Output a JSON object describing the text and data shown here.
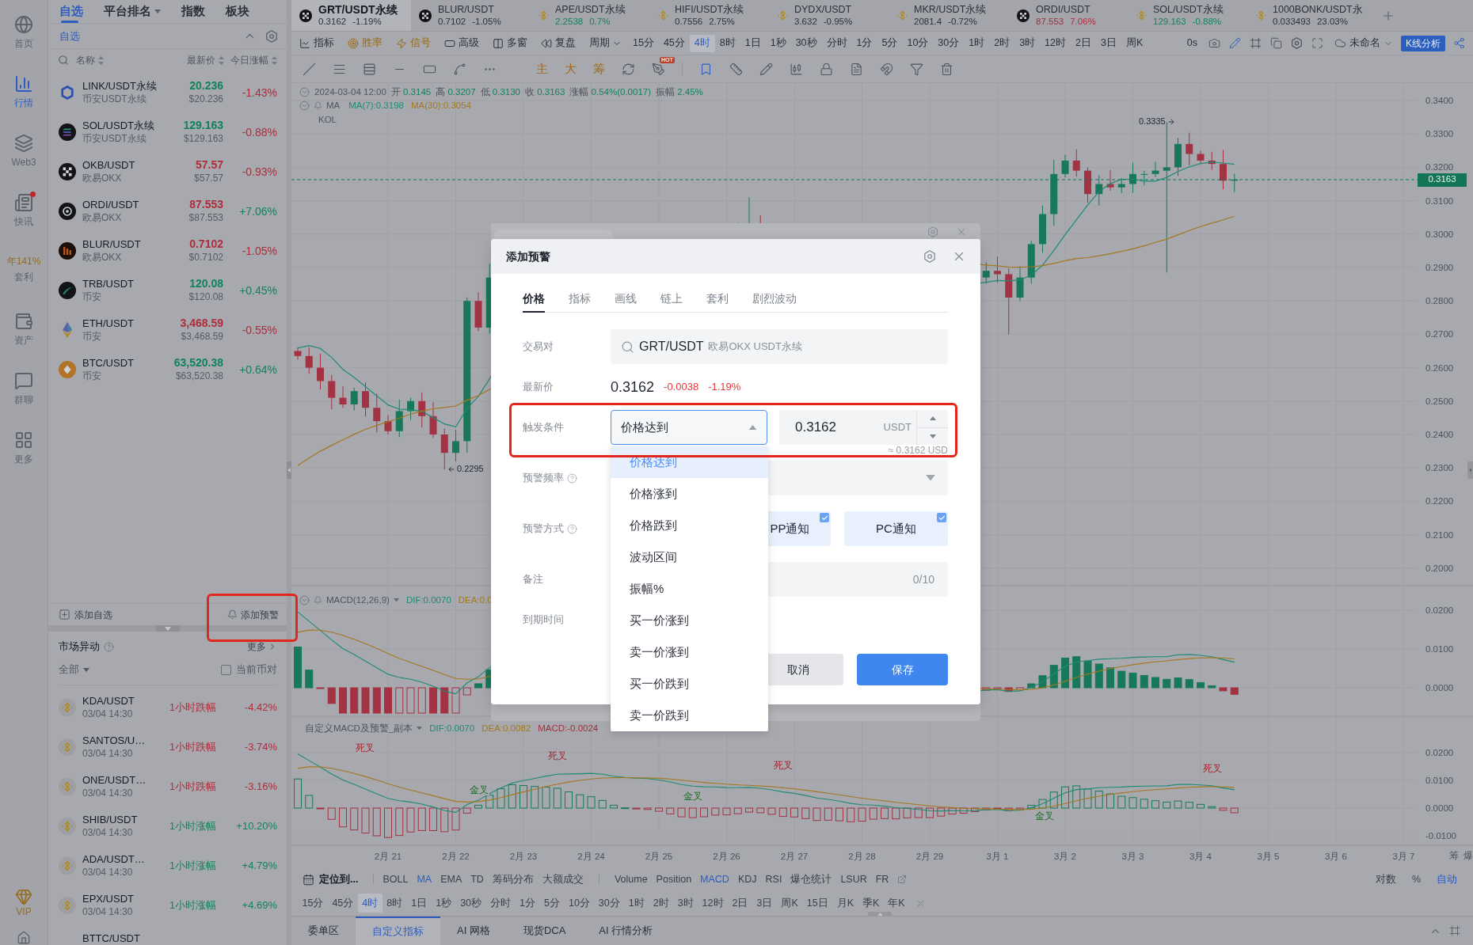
{
  "nav_rail": {
    "items": [
      {
        "kind": "nav",
        "label": "首页",
        "selected": false,
        "unread": false
      },
      {
        "kind": "nav",
        "label": "行情",
        "selected": true,
        "unread": false
      },
      {
        "kind": "nav",
        "label": "Web3",
        "selected": false,
        "unread": false
      },
      {
        "kind": "nav",
        "label": "快讯",
        "selected": false,
        "unread": true
      },
      {
        "kind": "promo",
        "highlight": "年141%",
        "label": "套利",
        "selected": false,
        "unread": false
      },
      {
        "kind": "nav",
        "label": "资产",
        "selected": false,
        "unread": false
      },
      {
        "kind": "nav",
        "label": "群聊",
        "selected": false,
        "unread": false
      },
      {
        "kind": "nav",
        "label": "更多",
        "selected": false,
        "unread": false
      }
    ],
    "vip": {
      "label": "VIP"
    }
  },
  "watchlist": {
    "tabs": [
      {
        "label": "自选",
        "selected": true,
        "dropdown": false
      },
      {
        "label": "平台排名",
        "selected": false,
        "dropdown": true
      },
      {
        "label": "指数",
        "selected": false,
        "dropdown": false
      },
      {
        "label": "板块",
        "selected": false,
        "dropdown": false
      }
    ],
    "group": {
      "title": "自选",
      "expanded": true
    },
    "columns": [
      {
        "label": "名称"
      },
      {
        "label": "最新价"
      },
      {
        "label": "今日涨幅"
      }
    ],
    "rows": [
      {
        "symbol": "LINK/USDT永续",
        "exchange": "币安USDT永续",
        "price": "20.236",
        "price_usd": "$20.236",
        "change": "-1.43%",
        "price_up": true,
        "change_up": false
      },
      {
        "symbol": "SOL/USDT永续",
        "exchange": "币安USDT永续",
        "price": "129.163",
        "price_usd": "$129.163",
        "change": "-0.88%",
        "price_up": true,
        "change_up": false
      },
      {
        "symbol": "OKB/USDT",
        "exchange": "欧易OKX",
        "price": "57.57",
        "price_usd": "$57.57",
        "change": "-0.93%",
        "price_up": false,
        "change_up": false
      },
      {
        "symbol": "ORDI/USDT",
        "exchange": "欧易OKX",
        "price": "87.553",
        "price_usd": "$87.553",
        "change": "+7.06%",
        "price_up": false,
        "change_up": true
      },
      {
        "symbol": "BLUR/USDT",
        "exchange": "欧易OKX",
        "price": "0.7102",
        "price_usd": "$0.7102",
        "change": "-1.05%",
        "price_up": false,
        "change_up": false
      },
      {
        "symbol": "TRB/USDT",
        "exchange": "币安",
        "price": "120.08",
        "price_usd": "$120.08",
        "change": "+0.45%",
        "price_up": true,
        "change_up": true
      },
      {
        "symbol": "ETH/USDT",
        "exchange": "币安",
        "price": "3,468.59",
        "price_usd": "$3,468.59",
        "change": "-0.55%",
        "price_up": false,
        "change_up": false
      },
      {
        "symbol": "BTC/USDT",
        "exchange": "币安",
        "price": "63,520.38",
        "price_usd": "$63,520.38",
        "change": "+0.64%",
        "price_up": true,
        "change_up": true
      }
    ],
    "footer": {
      "add_watchlist": "添加自选",
      "add_alert": {
        "label": "添加预警",
        "highlighted": true
      }
    }
  },
  "market_movers": {
    "title": "市场异动",
    "more": "更多",
    "filter": "全部",
    "current_pair": {
      "label": "当前币对",
      "checked": false
    },
    "rows": [
      {
        "symbol": "KDA/USDT",
        "time": "03/04 14:30",
        "metric": "1小时跌幅",
        "change": "-4.42%",
        "rising": false
      },
      {
        "symbol": "SANTOS/U…",
        "time": "03/04 14:30",
        "metric": "1小时跌幅",
        "change": "-3.74%",
        "rising": false
      },
      {
        "symbol": "ONE/USDT…",
        "time": "03/04 14:30",
        "metric": "1小时跌幅",
        "change": "-3.16%",
        "rising": false
      },
      {
        "symbol": "SHIB/USDT",
        "time": "03/04 14:30",
        "metric": "1小时涨幅",
        "change": "+10.20%",
        "rising": true
      },
      {
        "symbol": "ADA/USDT…",
        "time": "03/04 14:30",
        "metric": "1小时涨幅",
        "change": "+4.79%",
        "rising": true
      },
      {
        "symbol": "EPX/USDT",
        "time": "03/04 14:30",
        "metric": "1小时涨幅",
        "change": "+4.69%",
        "rising": true
      },
      {
        "symbol": "BTTC/USDT"
      }
    ]
  },
  "chart_tabs": {
    "tabs": [
      {
        "symbol": "GRT/USDT永续",
        "price": "0.3162",
        "change": "-1.19%",
        "color": "#2b303b",
        "kind": "checker",
        "selected": true
      },
      {
        "symbol": "BLUR/USDT",
        "price": "0.7102",
        "change": "-1.05%",
        "color": "#2b303b",
        "kind": "checker",
        "selected": false
      },
      {
        "symbol": "APE/USDT永续",
        "price": "2.2538",
        "change": "0.7%",
        "color": "#12825a",
        "kind": "diamond",
        "selected": false
      },
      {
        "symbol": "HIFI/USDT永续",
        "price": "0.7556",
        "change": "2.75%",
        "color": "#2b303b",
        "kind": "diamond",
        "selected": false
      },
      {
        "symbol": "DYDX/USDT",
        "price": "3.632",
        "change": "-0.95%",
        "color": "#2b303b",
        "kind": "diamond",
        "selected": false
      },
      {
        "symbol": "MKR/USDT永续",
        "price": "2081.4",
        "change": "-0.72%",
        "color": "#2b303b",
        "kind": "diamond",
        "selected": false
      },
      {
        "symbol": "ORDI/USDT",
        "price": "87.553",
        "change": "7.06%",
        "color": "#ad2d3c",
        "kind": "checker",
        "selected": false
      },
      {
        "symbol": "SOL/USDT永续",
        "price": "129.163",
        "change": "-0.88%",
        "color": "#12825a",
        "kind": "diamond",
        "selected": false
      },
      {
        "symbol": "1000BONK/USDT永",
        "price": "0.033493",
        "change": "23.03%",
        "color": "#2b303b",
        "kind": "diamond",
        "selected": false
      }
    ]
  },
  "toolbar": {
    "tools": [
      {
        "label": "指标",
        "kind": "plain"
      },
      {
        "label": "胜率",
        "kind": "accent"
      },
      {
        "label": "信号",
        "kind": "accent"
      },
      {
        "label": "高级",
        "kind": "plain"
      },
      {
        "label": "多窗",
        "kind": "plain"
      },
      {
        "label": "复盘",
        "kind": "plain"
      }
    ],
    "period_menu": "周期",
    "periods": [
      {
        "label": "15分",
        "selected": false
      },
      {
        "label": "45分",
        "selected": false
      },
      {
        "label": "4时",
        "selected": true
      },
      {
        "label": "8时",
        "selected": false
      },
      {
        "label": "1日",
        "selected": false
      },
      {
        "label": "1秒",
        "selected": false
      },
      {
        "label": "30秒",
        "selected": false
      },
      {
        "label": "分时",
        "selected": false
      },
      {
        "label": "1分",
        "selected": false
      },
      {
        "label": "5分",
        "selected": false
      },
      {
        "label": "10分",
        "selected": false
      },
      {
        "label": "30分",
        "selected": false
      },
      {
        "label": "1时",
        "selected": false
      },
      {
        "label": "2时",
        "selected": false
      },
      {
        "label": "3时",
        "selected": false
      },
      {
        "label": "12时",
        "selected": false
      },
      {
        "label": "2日",
        "selected": false
      },
      {
        "label": "3日",
        "selected": false
      },
      {
        "label": "周K",
        "selected": false
      }
    ],
    "delay": "0s",
    "layout_name": "未命名",
    "analysis_button": "K线分析"
  },
  "drawing_tools": {
    "text_tools": [
      {
        "label": "主"
      },
      {
        "label": "大"
      },
      {
        "label": "筹"
      }
    ],
    "hot_badge": "HOT",
    "sync_active": true
  },
  "legend": {
    "datetime": "2024-03-04 12:00",
    "fields": [
      {
        "label": "开",
        "value": "0.3145"
      },
      {
        "label": "高",
        "value": "0.3207"
      },
      {
        "label": "低",
        "value": "0.3130"
      },
      {
        "label": "收",
        "value": "0.3163"
      },
      {
        "label": "涨幅",
        "value": "0.54%(0.0017)"
      },
      {
        "label": "振幅",
        "value": "2.45%"
      }
    ],
    "ma_title": "MA",
    "ma": [
      {
        "label": "MA(7):0.3198",
        "color": "#1f8a76"
      },
      {
        "label": "MA(30):0.3054",
        "color": "#a5771f"
      }
    ],
    "source": "KOL"
  },
  "price_axis": {
    "labels": [
      "0.3400",
      "0.3300",
      "0.3200",
      "0.3100",
      "0.3000",
      "0.2900",
      "0.2800",
      "0.2700",
      "0.2600",
      "0.2500",
      "0.2400",
      "0.2300",
      "0.2200",
      "0.2100",
      "0.2000"
    ],
    "current": "0.3163"
  },
  "annotations": {
    "high": "0.3335",
    "low": "0.2295"
  },
  "macd_pane": {
    "title": "MACD(12,26,9)",
    "values": [
      {
        "label": "DIF:0.0070",
        "color": "#1f8a76"
      },
      {
        "label": "DEA:0.0",
        "color": "#a5771f"
      }
    ],
    "axis": [
      "0.0200",
      "0.0100",
      "0.0000"
    ]
  },
  "custom_pane": {
    "title": "自定义MACD及预警_副本",
    "values": [
      {
        "label": "DIF:0.0070",
        "color": "#1f8a76"
      },
      {
        "label": "DEA:0.0082",
        "color": "#a5771f"
      },
      {
        "label": "MACD:-0.0024",
        "color": "#a82c3a"
      }
    ],
    "axis": [
      "0.0200",
      "0.0100",
      "0.0000",
      "-0.0100"
    ],
    "signals": [
      {
        "label": "死叉",
        "kind": "death"
      },
      {
        "label": "金叉",
        "kind": "golden"
      },
      {
        "label": "死叉",
        "kind": "death"
      },
      {
        "label": "金叉",
        "kind": "golden"
      },
      {
        "label": "死叉",
        "kind": "death"
      },
      {
        "label": "金叉",
        "kind": "golden"
      },
      {
        "label": "死叉",
        "kind": "death"
      }
    ]
  },
  "date_axis": {
    "labels": [
      "2月 21",
      "2月 22",
      "2月 23",
      "2月 24",
      "2月 25",
      "2月 26",
      "2月 27",
      "2月 28",
      "2月 29",
      "3月 1",
      "3月 2",
      "3月 3",
      "3月 4",
      "3月 5",
      "3月 6",
      "3月 7"
    ],
    "toggles": [
      "筹",
      "爆"
    ]
  },
  "indicator_bar": {
    "locate": "定位到...",
    "main": [
      {
        "label": "BOLL",
        "selected": false
      },
      {
        "label": "MA",
        "selected": true
      },
      {
        "label": "EMA",
        "selected": false
      },
      {
        "label": "TD",
        "selected": false
      },
      {
        "label": "筹码分布",
        "selected": false
      },
      {
        "label": "大额成交",
        "selected": false
      }
    ],
    "sub": [
      {
        "label": "Volume",
        "selected": false
      },
      {
        "label": "Position",
        "selected": false
      },
      {
        "label": "MACD",
        "selected": true
      },
      {
        "label": "KDJ",
        "selected": false
      },
      {
        "label": "RSI",
        "selected": false
      },
      {
        "label": "爆仓统计",
        "selected": false
      },
      {
        "label": "LSUR",
        "selected": false
      },
      {
        "label": "FR",
        "selected": false
      }
    ],
    "scale": [
      {
        "label": "对数",
        "selected": false
      },
      {
        "label": "%",
        "selected": false
      },
      {
        "label": "自动",
        "selected": true
      }
    ]
  },
  "period_bar": {
    "periods": [
      {
        "label": "15分",
        "selected": false
      },
      {
        "label": "45分",
        "selected": false
      },
      {
        "label": "4时",
        "selected": true
      },
      {
        "label": "8时",
        "selected": false
      },
      {
        "label": "1日",
        "selected": false
      },
      {
        "label": "1秒",
        "selected": false
      },
      {
        "label": "30秒",
        "selected": false
      },
      {
        "label": "分时",
        "selected": false
      },
      {
        "label": "1分",
        "selected": false
      },
      {
        "label": "5分",
        "selected": false
      },
      {
        "label": "10分",
        "selected": false
      },
      {
        "label": "30分",
        "selected": false
      },
      {
        "label": "1时",
        "selected": false
      },
      {
        "label": "2时",
        "selected": false
      },
      {
        "label": "3时",
        "selected": false
      },
      {
        "label": "12时",
        "selected": false
      },
      {
        "label": "2日",
        "selected": false
      },
      {
        "label": "3日",
        "selected": false
      },
      {
        "label": "周K",
        "selected": false
      },
      {
        "label": "15日",
        "selected": false
      },
      {
        "label": "月K",
        "selected": false
      },
      {
        "label": "季K",
        "selected": false
      },
      {
        "label": "年K",
        "selected": false
      }
    ]
  },
  "bottom_tabs": {
    "tabs": [
      {
        "label": "委单区",
        "selected": false
      },
      {
        "label": "自定义指标",
        "selected": true
      },
      {
        "label": "AI 网格",
        "selected": false
      },
      {
        "label": "现货DCA",
        "selected": false
      },
      {
        "label": "AI 行情分析",
        "selected": false
      }
    ]
  },
  "modal_stack": {
    "hidden_dialog": true
  },
  "alert_dialog": {
    "title": "添加预警",
    "tabs": [
      {
        "label": "价格",
        "selected": true
      },
      {
        "label": "指标",
        "selected": false
      },
      {
        "label": "画线",
        "selected": false
      },
      {
        "label": "链上",
        "selected": false
      },
      {
        "label": "套利",
        "selected": false
      },
      {
        "label": "剧烈波动",
        "selected": false
      }
    ],
    "pair": {
      "label": "交易对",
      "symbol": "GRT/USDT",
      "market": "欧易OKX USDT永续"
    },
    "last_price": {
      "label": "最新价",
      "price": "0.3162",
      "change": "-0.0038",
      "change_pct": "-1.19%"
    },
    "trigger": {
      "label": "触发条件",
      "condition": "价格达到",
      "expanded": true,
      "highlighted": true,
      "price": "0.3162",
      "unit": "USDT",
      "approx": "≈ 0.3162 USD",
      "options": [
        {
          "label": "价格达到",
          "selected": true
        },
        {
          "label": "价格涨到",
          "selected": false
        },
        {
          "label": "价格跌到",
          "selected": false
        },
        {
          "label": "波动区间",
          "selected": false
        },
        {
          "label": "振幅%",
          "selected": false
        },
        {
          "label": "买一价涨到",
          "selected": false
        },
        {
          "label": "卖一价涨到",
          "selected": false
        },
        {
          "label": "买一价跌到",
          "selected": false
        },
        {
          "label": "卖一价跌到",
          "selected": false
        }
      ]
    },
    "frequency": {
      "label": "预警频率"
    },
    "method": {
      "label": "预警方式",
      "options": [
        {
          "label": "PP通知",
          "checked": true
        },
        {
          "label": "PC通知",
          "checked": true
        }
      ]
    },
    "note": {
      "label": "备注",
      "counter": "0/10"
    },
    "expiry": {
      "label": "到期时间"
    },
    "buttons": [
      {
        "label": "取消",
        "kind": "secondary"
      },
      {
        "label": "保存",
        "kind": "primary"
      }
    ]
  }
}
